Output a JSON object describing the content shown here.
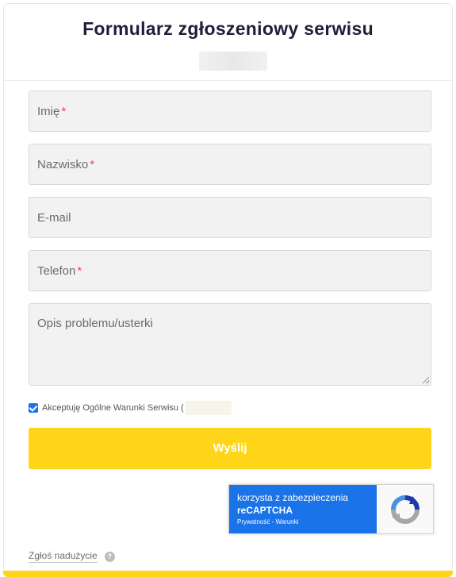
{
  "header": {
    "title": "Formularz zgłoszeniowy serwisu"
  },
  "form": {
    "first_name": {
      "placeholder": "Imię",
      "required_mark": "*"
    },
    "last_name": {
      "placeholder": "Nazwisko",
      "required_mark": "*"
    },
    "email": {
      "placeholder": "E-mail"
    },
    "phone": {
      "placeholder": "Telefon",
      "required_mark": "*"
    },
    "description": {
      "placeholder": "Opis problemu/usterki"
    },
    "consent": {
      "checked": true,
      "label": "Akceptuję Ogólne Warunki Serwisu ("
    },
    "submit_label": "Wyślij"
  },
  "recaptcha": {
    "line1": "korzysta z zabezpieczenia",
    "line2": "reCAPTCHA",
    "line3": "Prywatność - Warunki"
  },
  "footer": {
    "report_link": "Zgłoś nadużycie",
    "help_icon": "?"
  },
  "colors": {
    "accent": "#ffd51a",
    "title": "#1d1f3a",
    "required": "#e2466b",
    "recaptcha": "#1a73e8"
  }
}
